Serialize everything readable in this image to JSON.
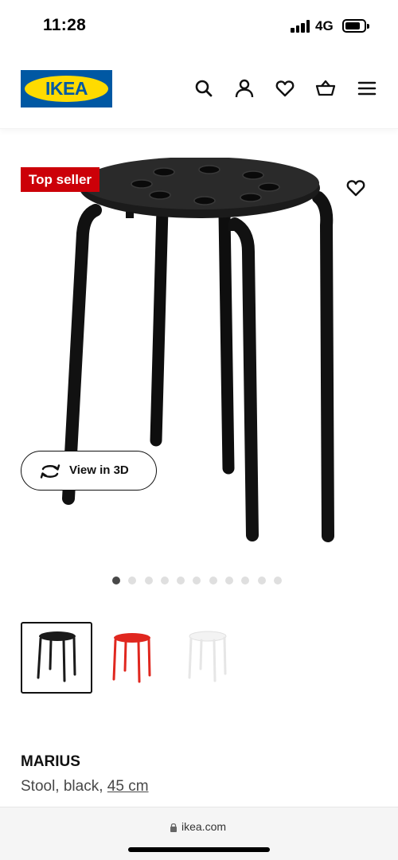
{
  "status_bar": {
    "time": "11:28",
    "network": "4G",
    "battery_level": 0.8,
    "icons": [
      "signal-icon",
      "battery-icon"
    ]
  },
  "header": {
    "logo_text": "IKEA",
    "icons": [
      "search-icon",
      "account-icon",
      "favorites-icon",
      "cart-icon",
      "menu-icon"
    ]
  },
  "gallery": {
    "badge": "Top seller",
    "view_3d_label": "View in 3D",
    "image_count": 11,
    "active_index": 0
  },
  "variants": [
    {
      "color": "black",
      "hex": "#1a1a1a",
      "selected": true
    },
    {
      "color": "red",
      "hex": "#e0271f",
      "selected": false
    },
    {
      "color": "white",
      "hex": "#f2f2f2",
      "selected": false
    }
  ],
  "product": {
    "name": "MARIUS",
    "desc_prefix": "Stool, black, ",
    "size": "45 cm"
  },
  "browser": {
    "url": "ikea.com"
  },
  "colors": {
    "ikea_blue": "#0058a3",
    "ikea_yellow": "#ffdb00",
    "badge_red": "#cc0008"
  }
}
